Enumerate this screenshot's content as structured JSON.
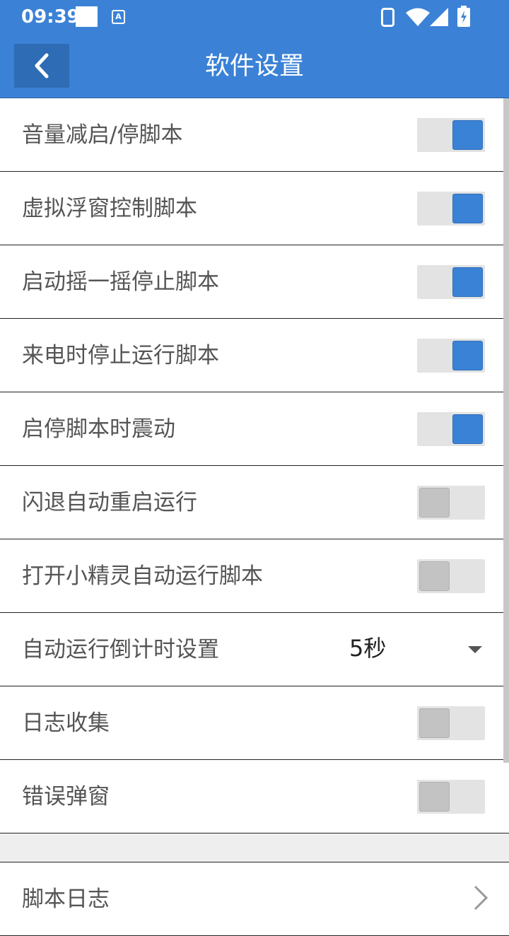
{
  "status_bar": {
    "time": "09:39",
    "indicator_letter": "A"
  },
  "app_bar": {
    "title": "软件设置"
  },
  "settings": {
    "items": [
      {
        "label": "音量减启/停脚本",
        "type": "toggle",
        "on": true
      },
      {
        "label": "虚拟浮窗控制脚本",
        "type": "toggle",
        "on": true
      },
      {
        "label": "启动摇一摇停止脚本",
        "type": "toggle",
        "on": true
      },
      {
        "label": "来电时停止运行脚本",
        "type": "toggle",
        "on": true
      },
      {
        "label": "启停脚本时震动",
        "type": "toggle",
        "on": true
      },
      {
        "label": "闪退自动重启运行",
        "type": "toggle",
        "on": false
      },
      {
        "label": "打开小精灵自动运行脚本",
        "type": "toggle",
        "on": false
      },
      {
        "label": "自动运行倒计时设置",
        "type": "dropdown",
        "value": "5秒"
      },
      {
        "label": "日志收集",
        "type": "toggle",
        "on": false
      },
      {
        "label": "错误弹窗",
        "type": "toggle",
        "on": false
      }
    ],
    "nav_item": {
      "label": "脚本日志"
    }
  },
  "colors": {
    "accent": "#3b82d6",
    "toggle_off_knob": "#c3c3c3",
    "track": "#e3e3e3"
  }
}
